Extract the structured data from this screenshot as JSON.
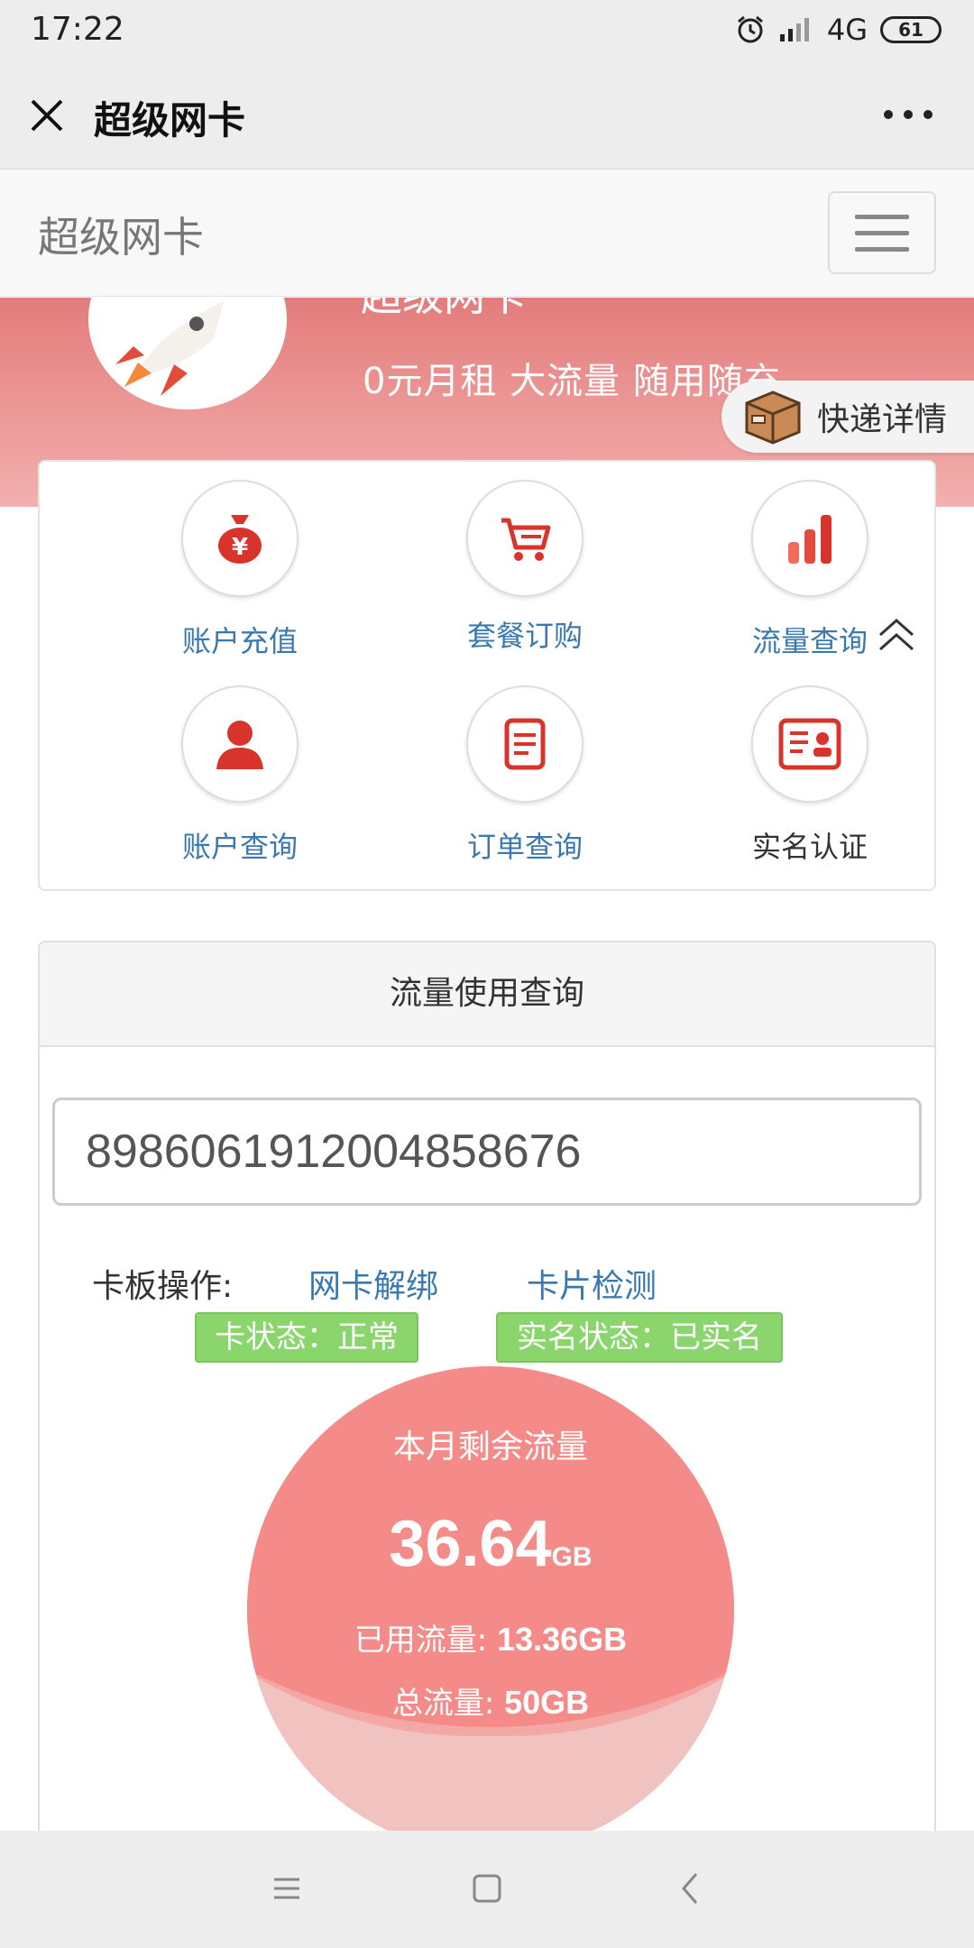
{
  "status_bar": {
    "time": "17:22",
    "network": "4G",
    "battery": "61"
  },
  "titlebar": {
    "title": "超级网卡"
  },
  "navbar": {
    "brand": "超级网卡"
  },
  "hero": {
    "title": "超级网卡",
    "slogan": "0元月租 大流量 随用随充"
  },
  "express": {
    "label": "快递详情"
  },
  "shortcuts": [
    {
      "label": "账户充值",
      "icon": "money-bag-icon"
    },
    {
      "label": "套餐订购",
      "icon": "cart-icon"
    },
    {
      "label": "流量查询",
      "icon": "bar-chart-icon"
    },
    {
      "label": "账户查询",
      "icon": "user-icon"
    },
    {
      "label": "订单查询",
      "icon": "document-icon"
    },
    {
      "label": "实名认证",
      "icon": "id-card-icon"
    }
  ],
  "query": {
    "title": "流量使用查询",
    "card_number": "8986061912004858676",
    "ops_label": "卡板操作:",
    "unbind_link": "网卡解绑",
    "check_link": "卡片检测",
    "card_status": "卡状态：正常",
    "realname_status": "实名状态：已实名"
  },
  "usage": {
    "remain_label": "本月剩余流量",
    "remain_value": "36.64",
    "remain_unit": "GB",
    "used_label": "已用流量: ",
    "used_value": "13.36GB",
    "total_label": "总流量: ",
    "total_value": "50GB",
    "used_fraction": 0.267
  },
  "colors": {
    "accent_red": "#d9342b",
    "link_blue": "#3a79b0",
    "badge_green": "#8bd66c",
    "water": "#f58b88"
  }
}
